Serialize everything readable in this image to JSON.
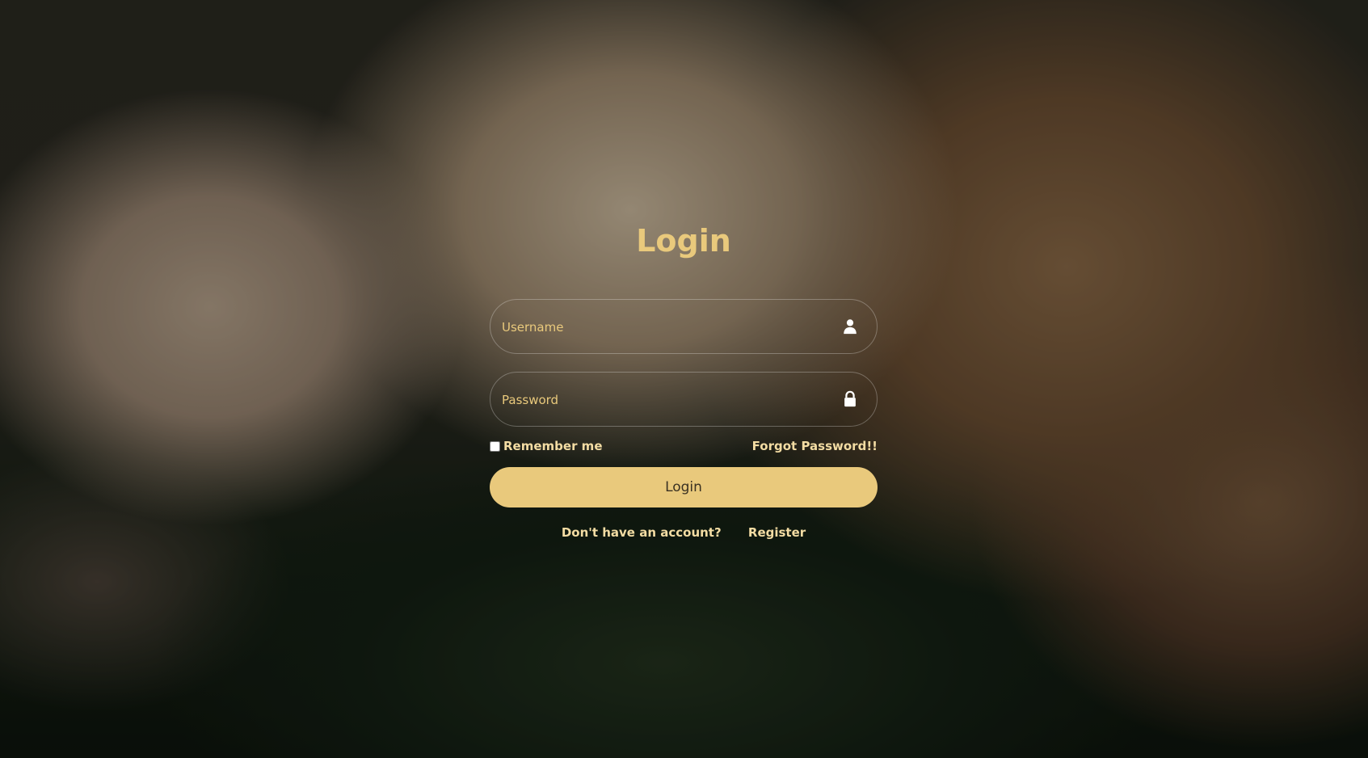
{
  "page": {
    "title": "Login",
    "accent_color": "#e9c97c",
    "background": "dark photo of two cats lying on green leaves"
  },
  "form": {
    "username": {
      "placeholder": "Username",
      "value": "",
      "icon": "user-icon"
    },
    "password": {
      "placeholder": "Password",
      "value": "",
      "icon": "lock-icon"
    },
    "remember_label": "Remember me",
    "remember_checked": false,
    "forgot_label": "Forgot Password!!",
    "submit_label": "Login",
    "no_account_label": "Don't have an account?",
    "register_label": "Register"
  }
}
